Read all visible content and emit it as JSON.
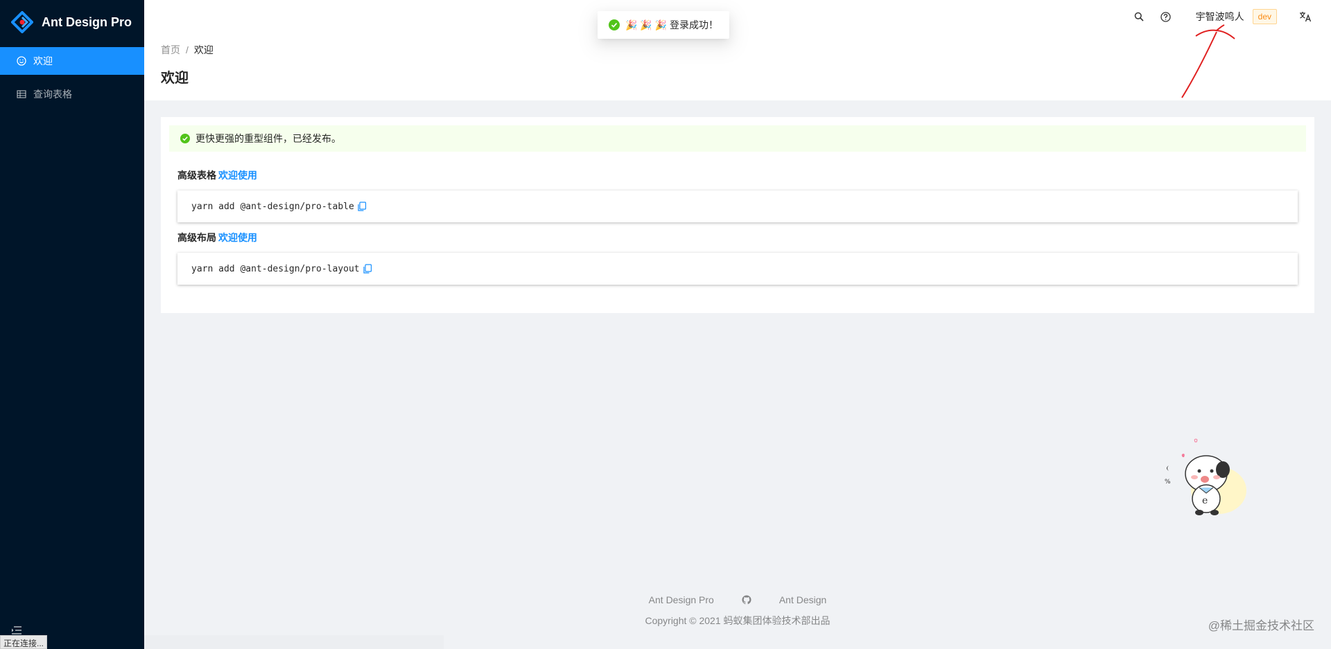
{
  "app": {
    "title": "Ant Design Pro"
  },
  "sidebar": {
    "items": [
      {
        "label": "欢迎",
        "icon": "smile-icon",
        "active": true
      },
      {
        "label": "查询表格",
        "icon": "table-icon",
        "active": false
      }
    ]
  },
  "header": {
    "user_name": "宇智波鸣人",
    "env_tag": "dev",
    "icons": [
      "search-icon",
      "question-icon",
      "translate-icon"
    ]
  },
  "toast": {
    "text": "🎉 🎉 🎉  登录成功！"
  },
  "breadcrumb": [
    "首页",
    "欢迎"
  ],
  "page": {
    "title": "欢迎"
  },
  "card": {
    "alert_text": "更快更强的重型组件，已经发布。",
    "sections": [
      {
        "title": "高级表格",
        "link": "欢迎使用",
        "code": "yarn add @ant-design/pro-table"
      },
      {
        "title": "高级布局",
        "link": "欢迎使用",
        "code": "yarn add @ant-design/pro-layout"
      }
    ]
  },
  "footer": {
    "links": [
      "Ant Design Pro",
      "Ant Design"
    ],
    "copyright": "Copyright © 2021 蚂蚁集团体验技术部出品"
  },
  "status_bar": {
    "text": "正在连接..."
  },
  "watermark": "@稀土掘金技术社区",
  "colors": {
    "primary": "#1890ff",
    "sider": "#001529",
    "success": "#52c41a",
    "annotation": "#e02020"
  }
}
